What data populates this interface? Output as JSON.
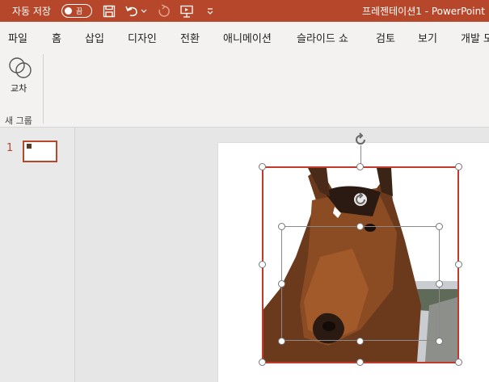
{
  "titlebar": {
    "autosave_label": "자동 저장",
    "toggle_state": "끔",
    "doc_title": "프레젠테이션1  -  PowerPoint",
    "icons": [
      "save-icon",
      "undo-icon",
      "redo-icon",
      "start-icon",
      "customize-icon"
    ]
  },
  "tabs": [
    "파일",
    "홈",
    "삽입",
    "디자인",
    "전환",
    "애니메이션",
    "슬라이드 쇼",
    "검토",
    "보기",
    "개발 도"
  ],
  "ribbon": {
    "intersect_label": "교차",
    "group_label": "새 그룹"
  },
  "thumbnails": {
    "slide_number": "1"
  },
  "colors": {
    "accent": "#b7472a",
    "selection": "#c0392b"
  }
}
